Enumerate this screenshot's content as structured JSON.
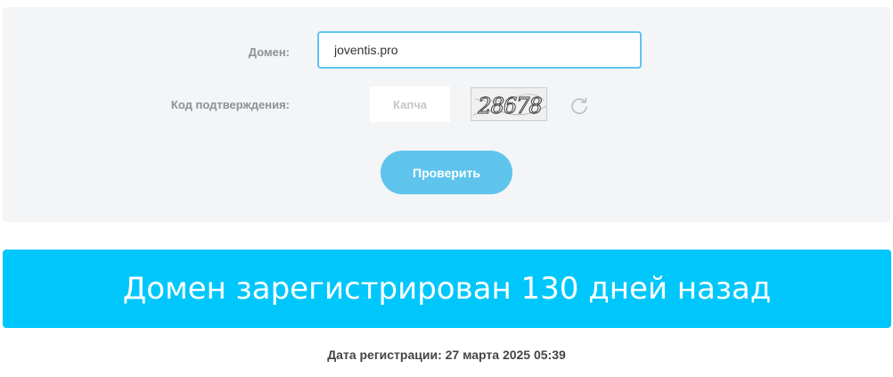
{
  "form": {
    "domain_label": "Домен:",
    "domain_value": "joventis.pro",
    "code_label": "Код подтверждения:",
    "captcha_placeholder": "Капча",
    "captcha_text": "28678",
    "submit_label": "Проверить"
  },
  "icons": {
    "refresh": "refresh-icon"
  },
  "result": {
    "headline": "Домен зарегистрирован 130 дней назад",
    "registration_date": "Дата регистрации: 27 марта 2025 05:39"
  },
  "colors": {
    "panel_bg": "#f3f5f6",
    "input_border": "#5fc2f0",
    "button_bg": "#5ec4ec",
    "banner_bg": "#00c7fb"
  }
}
